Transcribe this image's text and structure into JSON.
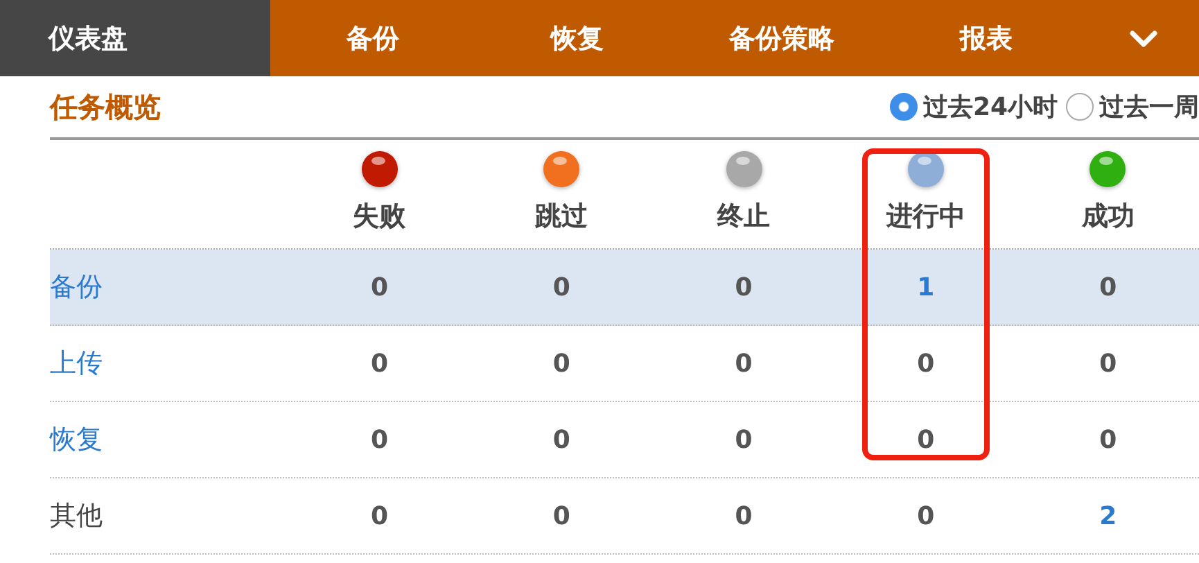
{
  "nav": {
    "items": [
      {
        "label": "仪表盘",
        "selected": true
      },
      {
        "label": "备份",
        "selected": false
      },
      {
        "label": "恢复",
        "selected": false
      },
      {
        "label": "备份策略",
        "selected": false
      },
      {
        "label": "报表",
        "selected": false
      }
    ]
  },
  "section": {
    "title": "任务概览",
    "range_options": [
      {
        "label": "过去24小时",
        "selected": true
      },
      {
        "label": "过去一周",
        "selected": false
      }
    ]
  },
  "table": {
    "columns": [
      {
        "label": "失败",
        "color": "#c01a00",
        "highlighted": false
      },
      {
        "label": "跳过",
        "color": "#f07020",
        "highlighted": false
      },
      {
        "label": "终止",
        "color": "#a8a8a8",
        "highlighted": false
      },
      {
        "label": "进行中",
        "color": "#8eaed8",
        "highlighted": true
      },
      {
        "label": "成功",
        "color": "#30b010",
        "highlighted": false
      }
    ],
    "rows": [
      {
        "label": "备份",
        "kind": "link",
        "selected": true,
        "cells": [
          {
            "value": "0",
            "link": false
          },
          {
            "value": "0",
            "link": false
          },
          {
            "value": "0",
            "link": false
          },
          {
            "value": "1",
            "link": true
          },
          {
            "value": "0",
            "link": false
          }
        ]
      },
      {
        "label": "上传",
        "kind": "link",
        "selected": false,
        "cells": [
          {
            "value": "0",
            "link": false
          },
          {
            "value": "0",
            "link": false
          },
          {
            "value": "0",
            "link": false
          },
          {
            "value": "0",
            "link": false
          },
          {
            "value": "0",
            "link": false
          }
        ]
      },
      {
        "label": "恢复",
        "kind": "link",
        "selected": false,
        "cells": [
          {
            "value": "0",
            "link": false
          },
          {
            "value": "0",
            "link": false
          },
          {
            "value": "0",
            "link": false
          },
          {
            "value": "0",
            "link": false
          },
          {
            "value": "0",
            "link": false
          }
        ]
      },
      {
        "label": "其他",
        "kind": "text",
        "selected": false,
        "cells": [
          {
            "value": "0",
            "link": false
          },
          {
            "value": "0",
            "link": false
          },
          {
            "value": "0",
            "link": false
          },
          {
            "value": "0",
            "link": false
          },
          {
            "value": "2",
            "link": true
          }
        ]
      }
    ]
  }
}
